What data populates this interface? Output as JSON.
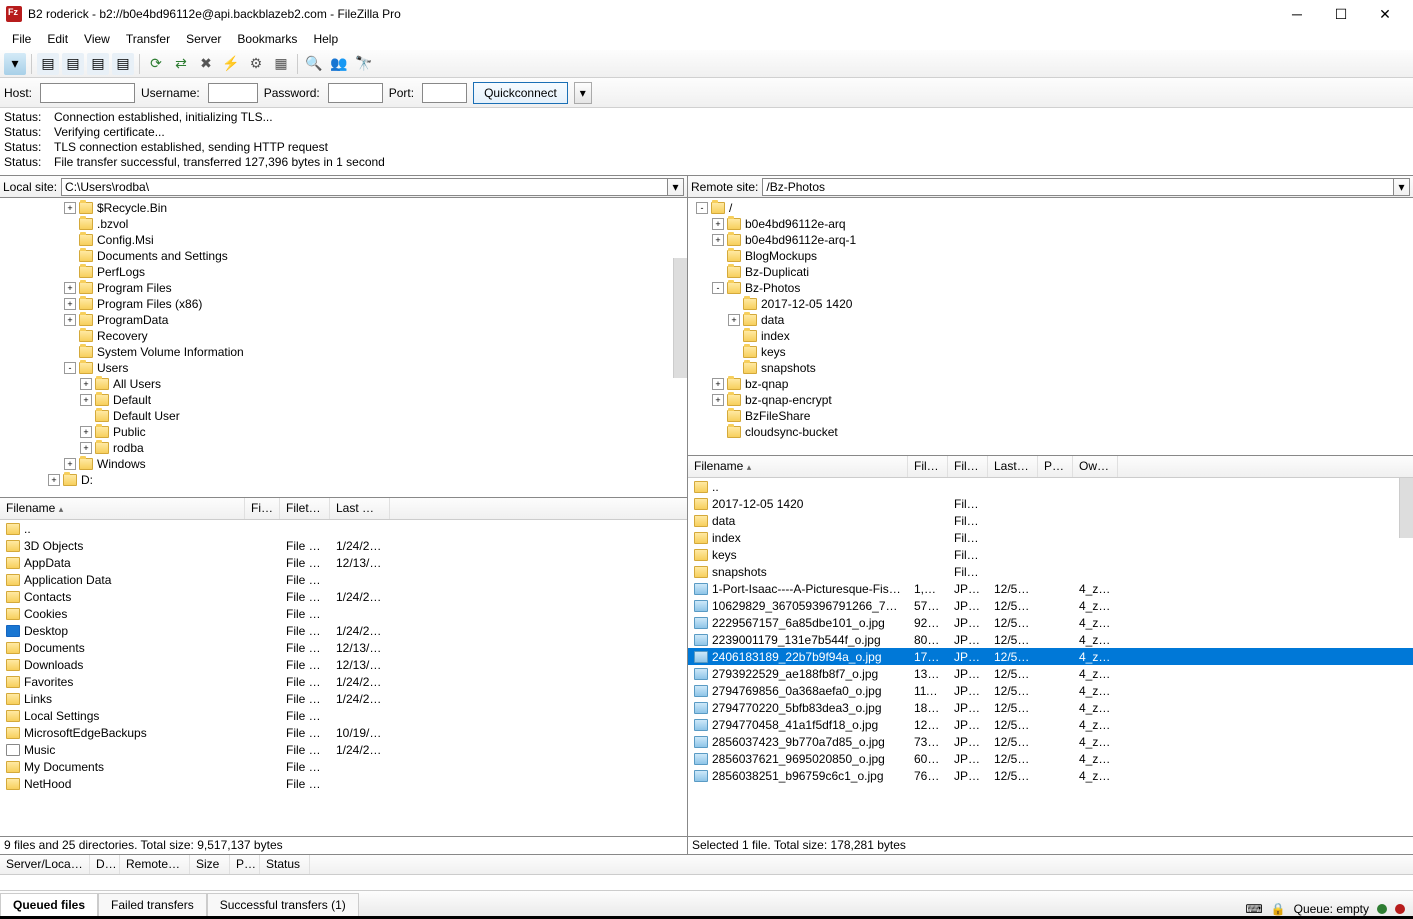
{
  "title": "B2 roderick - b2://b0e4bd96112e@api.backblazeb2.com - FileZilla Pro",
  "menu": [
    "File",
    "Edit",
    "View",
    "Transfer",
    "Server",
    "Bookmarks",
    "Help"
  ],
  "qc": {
    "host": "Host:",
    "user": "Username:",
    "pass": "Password:",
    "port": "Port:",
    "btn": "Quickconnect"
  },
  "status": [
    [
      "Status:",
      "Connection established, initializing TLS..."
    ],
    [
      "Status:",
      "Verifying certificate..."
    ],
    [
      "Status:",
      "TLS connection established, sending HTTP request"
    ],
    [
      "Status:",
      "File transfer successful, transferred 127,396 bytes in 1 second"
    ]
  ],
  "local": {
    "label": "Local site:",
    "path": "C:\\Users\\rodba\\",
    "tree": [
      {
        "d": 3,
        "e": "+",
        "n": "$Recycle.Bin"
      },
      {
        "d": 3,
        "e": "",
        "n": ".bzvol"
      },
      {
        "d": 3,
        "e": "",
        "n": "Config.Msi"
      },
      {
        "d": 3,
        "e": "",
        "n": "Documents and Settings"
      },
      {
        "d": 3,
        "e": "",
        "n": "PerfLogs"
      },
      {
        "d": 3,
        "e": "+",
        "n": "Program Files"
      },
      {
        "d": 3,
        "e": "+",
        "n": "Program Files (x86)"
      },
      {
        "d": 3,
        "e": "+",
        "n": "ProgramData"
      },
      {
        "d": 3,
        "e": "",
        "n": "Recovery"
      },
      {
        "d": 3,
        "e": "",
        "n": "System Volume Information"
      },
      {
        "d": 3,
        "e": "-",
        "n": "Users"
      },
      {
        "d": 4,
        "e": "+",
        "n": "All Users"
      },
      {
        "d": 4,
        "e": "+",
        "n": "Default"
      },
      {
        "d": 4,
        "e": "",
        "n": "Default User"
      },
      {
        "d": 4,
        "e": "+",
        "n": "Public"
      },
      {
        "d": 4,
        "e": "+",
        "n": "rodba",
        "icon": "user"
      },
      {
        "d": 3,
        "e": "+",
        "n": "Windows"
      },
      {
        "d": 2,
        "e": "+",
        "n": "D:"
      }
    ],
    "cols": [
      "Filename",
      "Filesi...",
      "Filetype",
      "Last mo..."
    ],
    "files": [
      {
        "n": "..",
        "t": "",
        "m": "",
        "i": "folder"
      },
      {
        "n": "3D Objects",
        "t": "File fol...",
        "m": "1/24/20...",
        "i": "obj"
      },
      {
        "n": "AppData",
        "t": "File fol...",
        "m": "12/13/2...",
        "i": "folder"
      },
      {
        "n": "Application Data",
        "t": "File fol...",
        "m": "",
        "i": "folder"
      },
      {
        "n": "Contacts",
        "t": "File fol...",
        "m": "1/24/20...",
        "i": "contacts"
      },
      {
        "n": "Cookies",
        "t": "File fol...",
        "m": "",
        "i": "folder"
      },
      {
        "n": "Desktop",
        "t": "File fol...",
        "m": "1/24/20...",
        "i": "desktop"
      },
      {
        "n": "Documents",
        "t": "File fol...",
        "m": "12/13/2...",
        "i": "docs"
      },
      {
        "n": "Downloads",
        "t": "File fol...",
        "m": "12/13/2...",
        "i": "down"
      },
      {
        "n": "Favorites",
        "t": "File fol...",
        "m": "1/24/20...",
        "i": "fav"
      },
      {
        "n": "Links",
        "t": "File fol...",
        "m": "1/24/20...",
        "i": "links"
      },
      {
        "n": "Local Settings",
        "t": "File fol...",
        "m": "",
        "i": "folder"
      },
      {
        "n": "MicrosoftEdgeBackups",
        "t": "File fol...",
        "m": "10/19/2...",
        "i": "folder"
      },
      {
        "n": "Music",
        "t": "File fol...",
        "m": "1/24/20...",
        "i": "music"
      },
      {
        "n": "My Documents",
        "t": "File fol...",
        "m": "",
        "i": "folder"
      },
      {
        "n": "NetHood",
        "t": "File fol...",
        "m": "",
        "i": "folder"
      }
    ],
    "summary": "9 files and 25 directories. Total size: 9,517,137 bytes"
  },
  "remote": {
    "label": "Remote site:",
    "path": "/Bz-Photos",
    "tree": [
      {
        "d": 0,
        "e": "-",
        "n": "/"
      },
      {
        "d": 1,
        "e": "+",
        "n": "b0e4bd96112e-arq"
      },
      {
        "d": 1,
        "e": "+",
        "n": "b0e4bd96112e-arq-1"
      },
      {
        "d": 1,
        "e": "",
        "n": "BlogMockups"
      },
      {
        "d": 1,
        "e": "",
        "n": "Bz-Duplicati"
      },
      {
        "d": 1,
        "e": "-",
        "n": "Bz-Photos"
      },
      {
        "d": 2,
        "e": "",
        "n": "2017-12-05 1420"
      },
      {
        "d": 2,
        "e": "+",
        "n": "data"
      },
      {
        "d": 2,
        "e": "",
        "n": "index"
      },
      {
        "d": 2,
        "e": "",
        "n": "keys"
      },
      {
        "d": 2,
        "e": "",
        "n": "snapshots"
      },
      {
        "d": 1,
        "e": "+",
        "n": "bz-qnap"
      },
      {
        "d": 1,
        "e": "+",
        "n": "bz-qnap-encrypt"
      },
      {
        "d": 1,
        "e": "",
        "n": "BzFileShare"
      },
      {
        "d": 1,
        "e": "",
        "n": "cloudsync-bucket"
      }
    ],
    "cols": [
      "Filename",
      "Files...",
      "Filet...",
      "Last m...",
      "Per...",
      "Own..."
    ],
    "files": [
      {
        "n": "..",
        "i": "folder"
      },
      {
        "n": "2017-12-05 1420",
        "t": "File f...",
        "i": "folder"
      },
      {
        "n": "data",
        "t": "File f...",
        "i": "folder"
      },
      {
        "n": "index",
        "t": "File f...",
        "i": "folder"
      },
      {
        "n": "keys",
        "t": "File f...",
        "i": "folder"
      },
      {
        "n": "snapshots",
        "t": "File f...",
        "i": "folder"
      },
      {
        "n": "1-Port-Isaac----A-Picturesque-Fishing-...",
        "s": "1,06...",
        "t": "JPG ...",
        "m": "12/5/2...",
        "o": "4_zc...",
        "i": "img"
      },
      {
        "n": "10629829_367059396791266_721589...",
        "s": "57,1...",
        "t": "JPG ...",
        "m": "12/5/2...",
        "o": "4_zc...",
        "i": "img"
      },
      {
        "n": "2229567157_6a85dbe101_o.jpg",
        "s": "92,4...",
        "t": "JPG ...",
        "m": "12/5/2...",
        "o": "4_zc...",
        "i": "img"
      },
      {
        "n": "2239001179_131e7b544f_o.jpg",
        "s": "80,6...",
        "t": "JPG ...",
        "m": "12/5/2...",
        "o": "4_zc...",
        "i": "img"
      },
      {
        "n": "2406183189_22b7b9f94a_o.jpg",
        "s": "178,...",
        "t": "JPG ...",
        "m": "12/5/2...",
        "o": "4_zc...",
        "i": "img",
        "sel": true
      },
      {
        "n": "2793922529_ae188fb8f7_o.jpg",
        "s": "130,...",
        "t": "JPG ...",
        "m": "12/5/2...",
        "o": "4_zc...",
        "i": "img"
      },
      {
        "n": "2794769856_0a368aefa0_o.jpg",
        "s": "111,...",
        "t": "JPG ...",
        "m": "12/5/2...",
        "o": "4_zc...",
        "i": "img"
      },
      {
        "n": "2794770220_5bfb83dea3_o.jpg",
        "s": "187,...",
        "t": "JPG ...",
        "m": "12/5/2...",
        "o": "4_zc...",
        "i": "img"
      },
      {
        "n": "2794770458_41a1f5df18_o.jpg",
        "s": "127,...",
        "t": "JPG ...",
        "m": "12/5/2...",
        "o": "4_zc...",
        "i": "img"
      },
      {
        "n": "2856037423_9b770a7d85_o.jpg",
        "s": "73,7...",
        "t": "JPG ...",
        "m": "12/5/2...",
        "o": "4_zc...",
        "i": "img"
      },
      {
        "n": "2856037621_9695020850_o.jpg",
        "s": "60,2...",
        "t": "JPG ...",
        "m": "12/5/2...",
        "o": "4_zc...",
        "i": "img"
      },
      {
        "n": "2856038251_b96759c6c1_o.jpg",
        "s": "76,3...",
        "t": "JPG ...",
        "m": "12/5/2...",
        "o": "4_zc...",
        "i": "img"
      }
    ],
    "summary": "Selected 1 file. Total size: 178,281 bytes"
  },
  "queue": {
    "cols": [
      "Server/Local fi...",
      "Dir...",
      "Remote file",
      "Size",
      "Pri...",
      "Status"
    ]
  },
  "tabs": [
    "Queued files",
    "Failed transfers",
    "Successful transfers (1)"
  ],
  "footer": {
    "queue": "Queue: empty"
  }
}
